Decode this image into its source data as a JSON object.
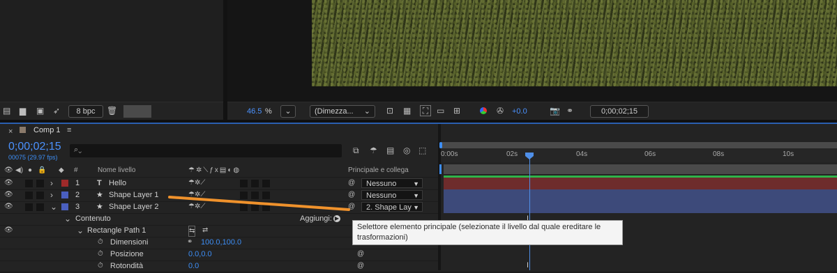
{
  "project": {
    "bpc": "8 bpc"
  },
  "viewer": {
    "zoom": "46.5",
    "zoom_unit": "%",
    "resolution": "(Dimezza...",
    "exposure": "+0.0",
    "timecode": "0;00;02;15"
  },
  "timeline": {
    "comp_name": "Comp 1",
    "menu_glyph": "≡",
    "close_glyph": "×",
    "current_time": "0;00;02;15",
    "frame_info": "00075 (29.97 fps)",
    "search_placeholder": "",
    "headers": {
      "number": "#",
      "name": "Nome livello",
      "parent": "Principale e collega"
    },
    "ruler": [
      "0:00s",
      "02s",
      "04s",
      "06s",
      "08s",
      "10s"
    ],
    "layers": [
      {
        "index": "1",
        "type_icon": "T",
        "name": "Hello",
        "parent": "Nessuno",
        "color": "#9e2a2a"
      },
      {
        "index": "2",
        "type_icon": "★",
        "name": "Shape Layer 1",
        "parent": "Nessuno",
        "color": "#4a5fbf"
      },
      {
        "index": "3",
        "type_icon": "★",
        "name": "Shape Layer 2",
        "parent": "2. Shape Lay",
        "color": "#4a5fbf"
      }
    ],
    "contents_label": "Contenuto",
    "add_label": "Aggiungi:",
    "rect_path_label": "Rectangle Path 1",
    "properties": [
      {
        "label": "Dimensioni",
        "value": "100.0,100.0"
      },
      {
        "label": "Posizione",
        "value": "0.0,0.0"
      },
      {
        "label": "Rotondità",
        "value": "0.0"
      }
    ],
    "tooltip": "Selettore elemento principale (selezionate il livello dal quale ereditare le trasformazioni)"
  },
  "colors": {
    "accent": "#4b92ff",
    "green_bar": "#2fb34a",
    "red_bar": "#7a2d2d",
    "blue_bar": "#3d4a7a",
    "arrow": "#f0922c"
  }
}
